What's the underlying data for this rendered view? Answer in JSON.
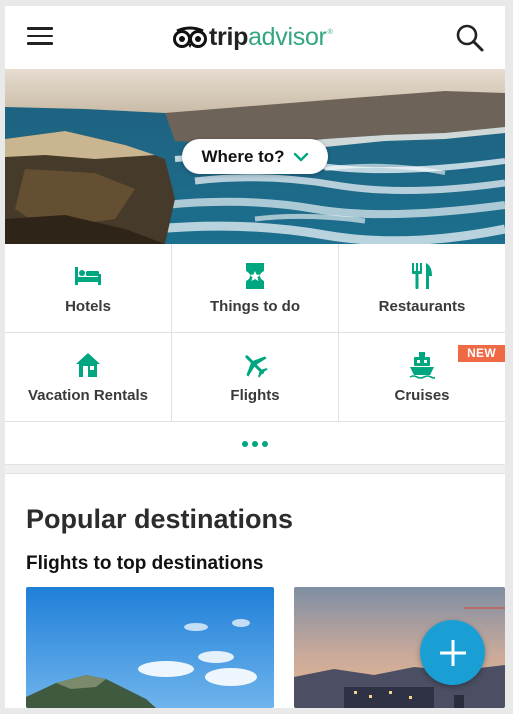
{
  "header": {
    "logo_trip": "trip",
    "logo_advisor": "advisor",
    "logo_reg": "®"
  },
  "hero": {
    "search_label": "Where to?"
  },
  "categories": [
    {
      "label": "Hotels",
      "icon": "bed-icon"
    },
    {
      "label": "Things to do",
      "icon": "ticket-icon"
    },
    {
      "label": "Restaurants",
      "icon": "fork-knife-icon"
    },
    {
      "label": "Vacation Rentals",
      "icon": "house-icon"
    },
    {
      "label": "Flights",
      "icon": "plane-icon"
    },
    {
      "label": "Cruises",
      "icon": "ship-icon",
      "badge": "NEW"
    }
  ],
  "popular": {
    "title": "Popular destinations",
    "subtitle": "Flights to top destinations"
  },
  "colors": {
    "brand_green": "#34a67e",
    "icon_green": "#00a680",
    "badge_orange": "#ef6945",
    "fab_blue": "#1a9fd4"
  }
}
